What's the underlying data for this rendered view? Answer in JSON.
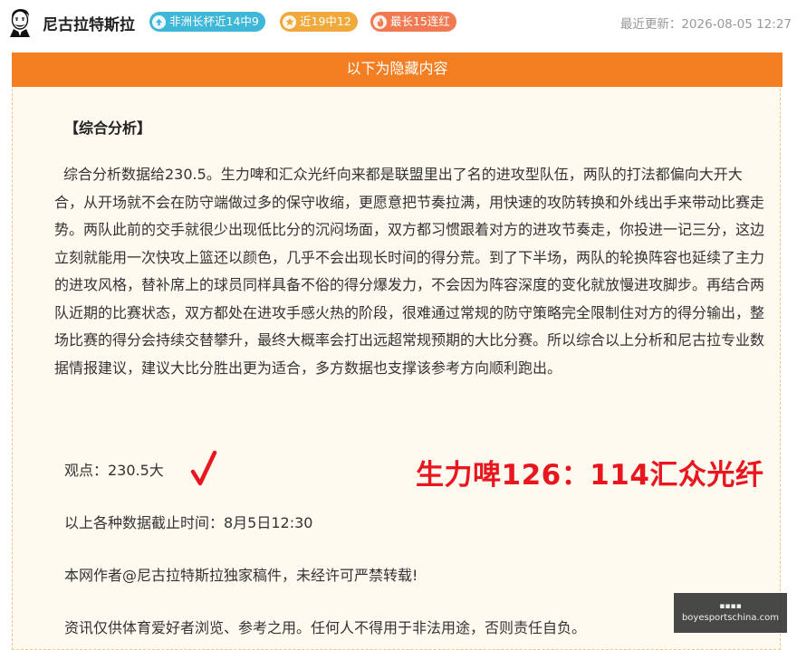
{
  "header": {
    "author_name": "尼古拉特斯拉",
    "badges": [
      {
        "label": "非洲长杯近14中9",
        "icon": "arrow-up-icon",
        "color": "#3fb7d8"
      },
      {
        "label": "近19中12",
        "icon": "star-icon",
        "color": "#f0a93a"
      },
      {
        "label": "最长15连红",
        "icon": "flame-icon",
        "color": "#f07a52"
      }
    ],
    "last_updated": "最近更新：2026-08-05 12:27"
  },
  "panel": {
    "header_title": "以下为隐藏内容",
    "accent_color": "#f37f22",
    "section_title": "【综合分析】",
    "analysis_text": "综合分析数据给230.5。生力啤和汇众光纤向来都是联盟里出了名的进攻型队伍，两队的打法都偏向大开大合，从开场就不会在防守端做过多的保守收缩，更愿意把节奏拉满，用快速的攻防转换和外线出手来带动比赛走势。两队此前的交手就很少出现低比分的沉闷场面，双方都习惯跟着对方的进攻节奏走，你投进一记三分，这边立刻就能用一次快攻上篮还以颜色，几乎不会出现长时间的得分荒。到了下半场，两队的轮换阵容也延续了主力的进攻风格，替补席上的球员同样具备不俗的得分爆发力，不会因为阵容深度的变化就放慢进攻脚步。再结合两队近期的比赛状态，双方都处在进攻手感火热的阶段，很难通过常规的防守策略完全限制住对方的得分输出，整场比赛的得分会持续交替攀升，最终大概率会打出远超常规预期的大比分赛。所以综合以上分析和尼古拉专业数据情报建议，建议大比分胜出更为适合，多方数据也支撑该参考方向顺利跑出。",
    "opinion": "观点：230.5大",
    "check_mark": "√",
    "check_color": "#e8161e",
    "final_score": "生力啤126：114汇众光纤",
    "cutoff_time": "以上各种数据截止时间：8月5日12:30",
    "copyright": "本网作者@尼古拉特斯拉独家稿件，未经许可严禁转载!",
    "disclaimer": "资讯仅供体育爱好者浏览、参考之用。任何人不得用于非法用途，否则责任自负。"
  },
  "watermark": {
    "top_text": "▪▪▪▪",
    "site": "boyesportschina.com"
  }
}
